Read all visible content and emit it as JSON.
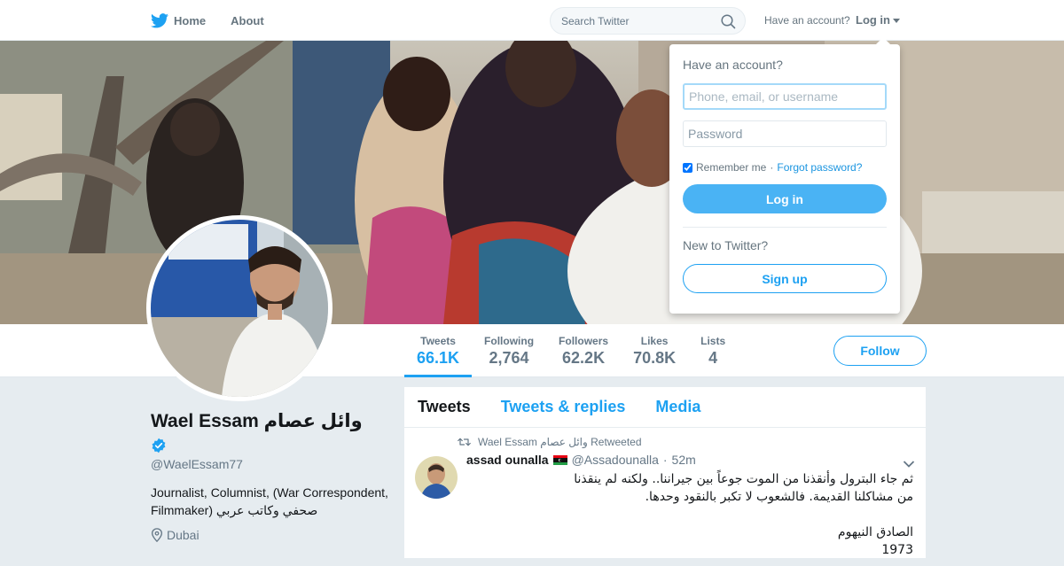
{
  "nav": {
    "home_label": "Home",
    "about_label": "About"
  },
  "search": {
    "placeholder": "Search Twitter"
  },
  "account": {
    "prompt": "Have an account?",
    "login_label": "Log in"
  },
  "profile": {
    "name": "Wael Essam وائل عصام",
    "verified": true,
    "handle": "@WaelEssam77",
    "bio": "Journalist, Columnist, (War Correspondent, Filmmaker) صحفي وكاتب عربي",
    "location": "Dubai"
  },
  "stats": [
    {
      "label": "Tweets",
      "value": "66.1K"
    },
    {
      "label": "Following",
      "value": "2,764"
    },
    {
      "label": "Followers",
      "value": "62.2K"
    },
    {
      "label": "Likes",
      "value": "70.8K"
    },
    {
      "label": "Lists",
      "value": "4"
    }
  ],
  "follow_label": "Follow",
  "tabs": [
    "Tweets",
    "Tweets & replies",
    "Media"
  ],
  "tweet": {
    "retweeted_by": "Wael Essam وائل عصام Retweeted",
    "author_name": "assad ounalla",
    "author_handle": "@Assadounalla",
    "time": "52m",
    "separator": "·",
    "text_line1": "ثم جاء البترول وأنقذنا من الموت جوعاً بين جيراننا.. ولكنه لم ينقذنا",
    "text_line2": "من مشاكلنا القديمة. فالشعوب لا تكبر بالنقود وحدها.",
    "text_line3": "الصادق النيهوم",
    "text_line4": "1973"
  },
  "login_popup": {
    "title": "Have an account?",
    "username_placeholder": "Phone, email, or username",
    "password_placeholder": "Password",
    "remember_label": "Remember me",
    "separator": "·",
    "forgot_label": "Forgot password?",
    "login_button": "Log in",
    "new_prompt": "New to Twitter?",
    "signup_button": "Sign up"
  },
  "colors": {
    "brand": "#1da1f2",
    "login_button": "#4ab3f4",
    "background": "#e6ecf0"
  }
}
